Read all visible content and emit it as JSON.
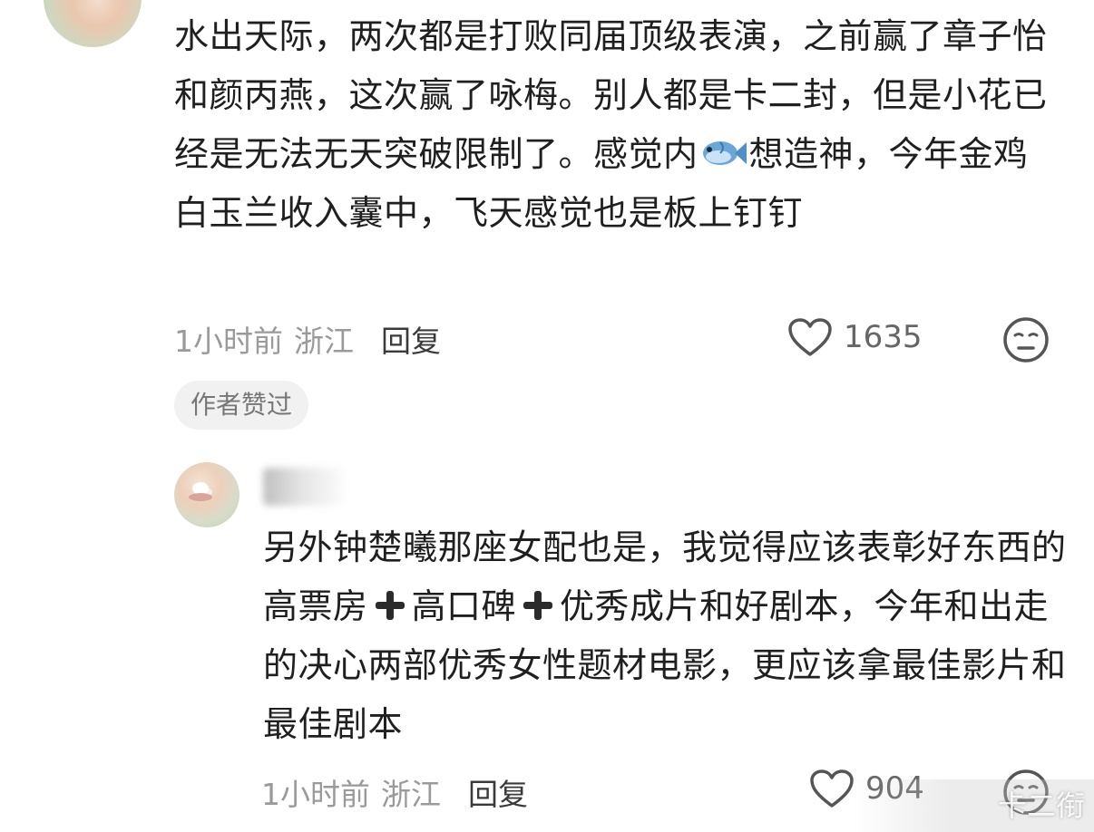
{
  "comment_1": {
    "text_part1": "水出天际，两次都是打败同届顶级表演，之前赢了章子怡和颜丙燕，这次赢了咏梅。别人都是卡二封，但是小花已经是无法无天突破限制了。感觉内",
    "emoji": "fish-emoji",
    "text_part2": "想造神，今年金鸡白玉兰收入囊中，飞天感觉也是板上钉钉",
    "time": "1小时前",
    "region": "浙江",
    "reply_label": "回复",
    "like_count": "1635",
    "author_liked_badge": "作者赞过"
  },
  "comment_2": {
    "username_visible": "...",
    "text_part1": "另外钟楚曦那座女配也是，我觉得应该表彰好东西的高票房",
    "text_part2": "高口碑",
    "text_part3": "优秀成片和好剧本，今年和出走的决心两部优秀女性题材电影，更应该拿最佳影片和最佳剧本",
    "time": "1小时前",
    "region": "浙江",
    "reply_label": "回复",
    "like_count": "904"
  },
  "watermark": "卡二衔",
  "colors": {
    "text_primary": "#1f1f1f",
    "text_meta": "#9a9a9a",
    "badge_bg": "#f1f1f1"
  }
}
